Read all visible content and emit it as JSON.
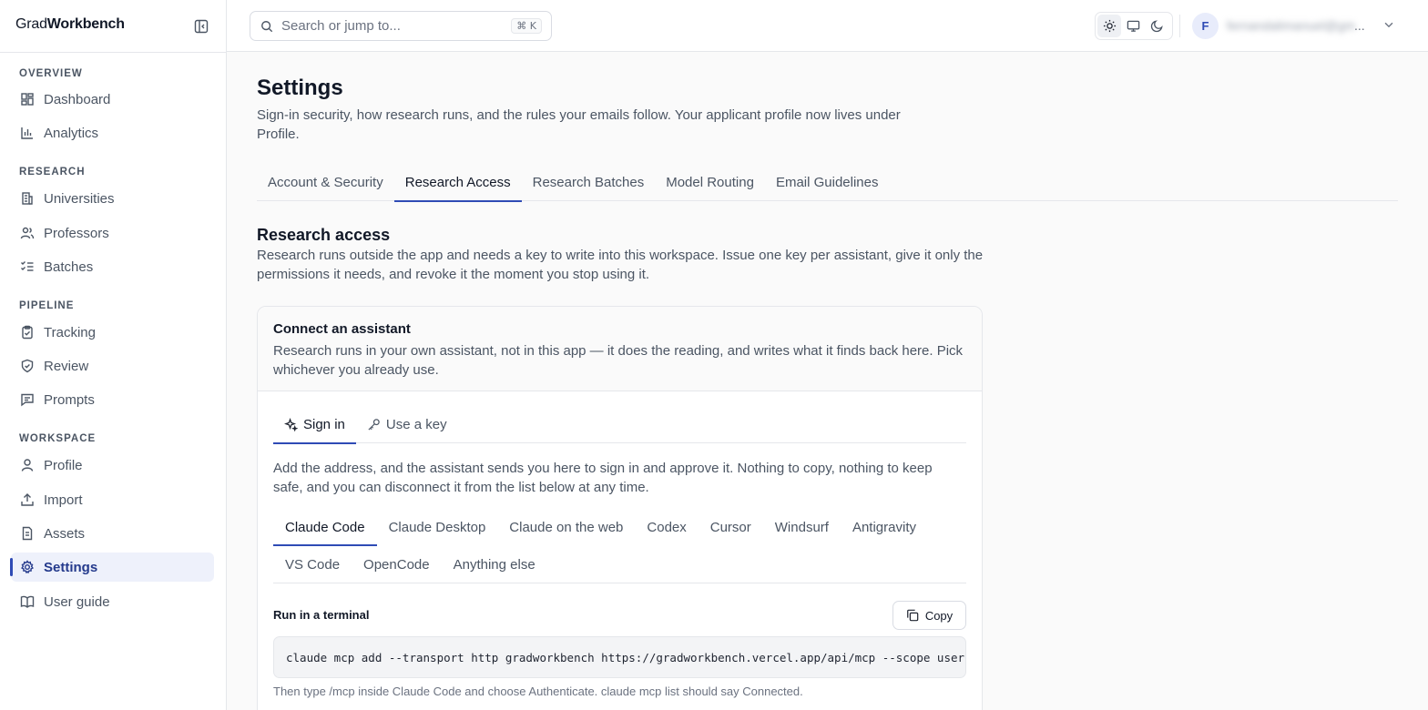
{
  "brand": {
    "prefix": "Grad",
    "suffix": "Workbench"
  },
  "search": {
    "placeholder": "Search or jump to...",
    "shortcut": "⌘ K"
  },
  "user": {
    "initial": "F",
    "name": "fernandalimanuel@gm",
    "ellipsis": "..."
  },
  "sidebar": {
    "sections": [
      {
        "label": "OVERVIEW",
        "items": [
          {
            "label": "Dashboard",
            "icon": "dashboard-icon"
          },
          {
            "label": "Analytics",
            "icon": "bar-chart-icon"
          }
        ]
      },
      {
        "label": "RESEARCH",
        "items": [
          {
            "label": "Universities",
            "icon": "building-icon"
          },
          {
            "label": "Professors",
            "icon": "users-icon"
          },
          {
            "label": "Batches",
            "icon": "list-checks-icon"
          }
        ]
      },
      {
        "label": "PIPELINE",
        "items": [
          {
            "label": "Tracking",
            "icon": "clipboard-check-icon"
          },
          {
            "label": "Review",
            "icon": "shield-check-icon"
          },
          {
            "label": "Prompts",
            "icon": "message-square-icon"
          }
        ]
      },
      {
        "label": "WORKSPACE",
        "items": [
          {
            "label": "Profile",
            "icon": "user-icon"
          },
          {
            "label": "Import",
            "icon": "upload-icon"
          },
          {
            "label": "Assets",
            "icon": "file-icon"
          },
          {
            "label": "Settings",
            "icon": "gear-icon",
            "active": true
          },
          {
            "label": "User guide",
            "icon": "book-icon"
          }
        ]
      }
    ]
  },
  "page": {
    "title": "Settings",
    "subtitle": "Sign-in security, how research runs, and the rules your emails follow. Your applicant profile now lives under Profile.",
    "tabs": [
      "Account & Security",
      "Research Access",
      "Research Batches",
      "Model Routing",
      "Email Guidelines"
    ],
    "active_tab": "Research Access"
  },
  "research_access": {
    "title": "Research access",
    "description": "Research runs outside the app and needs a key to write into this workspace. Issue one key per assistant, give it only the permissions it needs, and revoke it the moment you stop using it."
  },
  "connect_card": {
    "title": "Connect an assistant",
    "description": "Research runs in your own assistant, not in this app — it does the reading, and writes what it finds back here. Pick whichever you already use.",
    "method_tabs": [
      "Sign in",
      "Use a key"
    ],
    "active_method": "Sign in",
    "signin_description": "Add the address, and the assistant sends you here to sign in and approve it. Nothing to copy, nothing to keep safe, and you can disconnect it from the list below at any time.",
    "clients": [
      "Claude Code",
      "Claude Desktop",
      "Claude on the web",
      "Codex",
      "Cursor",
      "Windsurf",
      "Antigravity",
      "VS Code",
      "OpenCode",
      "Anything else"
    ],
    "active_client": "Claude Code",
    "terminal_label": "Run in a terminal",
    "copy_label": "Copy",
    "command": "claude mcp add --transport http gradworkbench https://gradworkbench.vercel.app/api/mcp --scope user",
    "hint": "Then type /mcp inside Claude Code and choose Authenticate. claude mcp list should say Connected."
  },
  "colors": {
    "accent": "#2f4bb5",
    "active_bg": "#eef1fb",
    "border": "#e5e7eb",
    "text_muted": "#4b5563"
  }
}
